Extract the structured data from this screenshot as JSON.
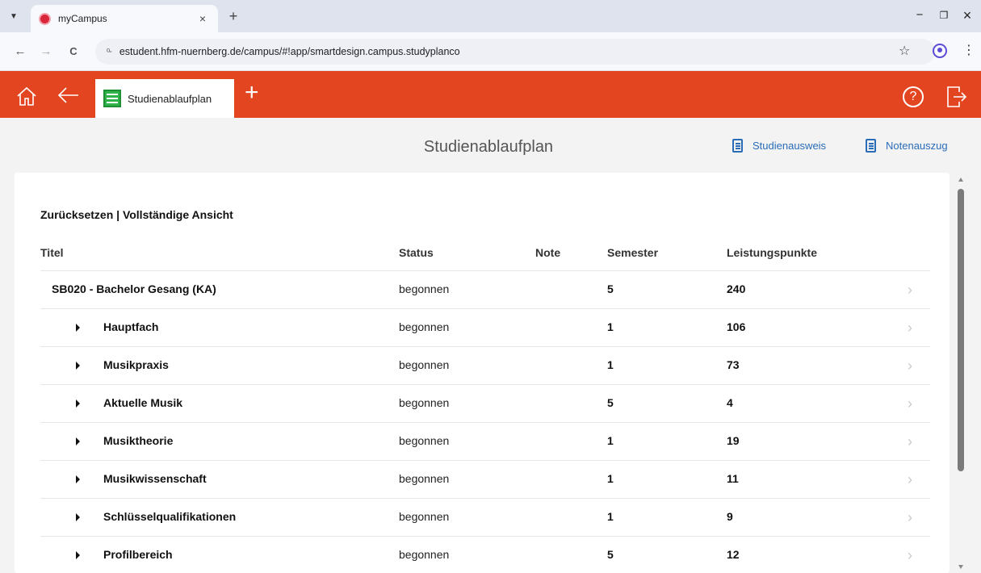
{
  "browser": {
    "tab_title": "myCampus",
    "tab_close": "×",
    "new_tab": "+",
    "url": "estudent.hfm-nuernberg.de/campus/#!app/smartdesign.campus.studyplanco",
    "site_info": "ᵒ-",
    "controls": {
      "minimize": "−",
      "restore": "❐",
      "close": "×"
    },
    "nav": {
      "back": "←",
      "forward": "→",
      "reload": "C"
    },
    "star": "☆",
    "menu": "⋮"
  },
  "app": {
    "tab_label": "Studienablaufplan",
    "plus": "+",
    "help": "?",
    "colors": {
      "header": "#e2451f",
      "link": "#2a6cb8",
      "tab_icon": "#2eb24a"
    }
  },
  "subheader": {
    "title": "Studienablaufplan",
    "links": [
      "Studienausweis",
      "Notenauszug"
    ]
  },
  "table": {
    "reset_label": "Zurücksetzen | Vollständige Ansicht",
    "columns": [
      "Titel",
      "Status",
      "Note",
      "Semester",
      "Leistungspunkte"
    ],
    "rows": [
      {
        "title": "SB020 - Bachelor Gesang (KA)",
        "status": "begonnen",
        "note": "",
        "semester": "5",
        "points": "240"
      },
      {
        "title": "Hauptfach",
        "status": "begonnen",
        "note": "",
        "semester": "1",
        "points": "106"
      },
      {
        "title": "Musikpraxis",
        "status": "begonnen",
        "note": "",
        "semester": "1",
        "points": "73"
      },
      {
        "title": "Aktuelle Musik",
        "status": "begonnen",
        "note": "",
        "semester": "5",
        "points": "4"
      },
      {
        "title": "Musiktheorie",
        "status": "begonnen",
        "note": "",
        "semester": "1",
        "points": "19"
      },
      {
        "title": "Musikwissenschaft",
        "status": "begonnen",
        "note": "",
        "semester": "1",
        "points": "11"
      },
      {
        "title": "Schlüsselqualifikationen",
        "status": "begonnen",
        "note": "",
        "semester": "1",
        "points": "9"
      },
      {
        "title": "Profilbereich",
        "status": "begonnen",
        "note": "",
        "semester": "5",
        "points": "12"
      }
    ]
  }
}
